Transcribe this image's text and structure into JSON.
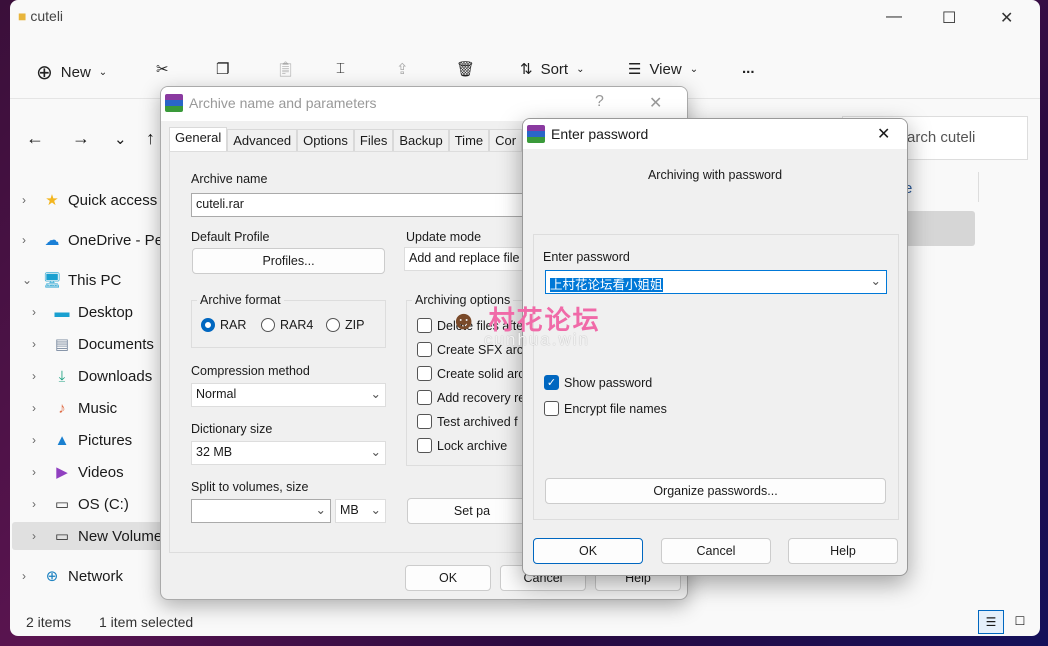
{
  "explorer": {
    "title": "cuteli",
    "toolbar": {
      "new": "New",
      "sort": "Sort",
      "view": "View",
      "more": "..."
    },
    "search_placeholder": "Search cuteli",
    "search_visible": "arch cuteli",
    "col_fragment": "e",
    "sidebar": [
      {
        "label": "Quick access",
        "icon": "star-icon",
        "expanded": false
      },
      {
        "label": "OneDrive - Per",
        "icon": "cloud-icon"
      },
      {
        "label": "This PC",
        "icon": "computer-icon",
        "expanded": true
      },
      {
        "label": "Desktop",
        "icon": "desktop-icon"
      },
      {
        "label": "Documents",
        "icon": "documents-icon"
      },
      {
        "label": "Downloads",
        "icon": "download-icon"
      },
      {
        "label": "Music",
        "icon": "music-icon"
      },
      {
        "label": "Pictures",
        "icon": "pictures-icon"
      },
      {
        "label": "Videos",
        "icon": "videos-icon"
      },
      {
        "label": "OS (C:)",
        "icon": "drive-icon"
      },
      {
        "label": "New Volume",
        "icon": "drive-icon",
        "selected": true
      },
      {
        "label": "Network",
        "icon": "network-icon"
      }
    ],
    "status": {
      "items": "2 items",
      "selected": "1 item selected"
    }
  },
  "archive": {
    "title": "Archive name and parameters",
    "help": "?",
    "tabs": [
      "General",
      "Advanced",
      "Options",
      "Files",
      "Backup",
      "Time",
      "Cor"
    ],
    "archive_name_label": "Archive name",
    "archive_name": "cuteli.rar",
    "default_profile": "Default Profile",
    "profiles": "Profiles...",
    "update_mode_label": "Update mode",
    "update_mode": "Add and replace file",
    "format_label": "Archive format",
    "formats": [
      "RAR",
      "RAR4",
      "ZIP"
    ],
    "format_selected": "RAR",
    "compression_label": "Compression method",
    "compression": "Normal",
    "dict_label": "Dictionary size",
    "dict": "32 MB",
    "split_label": "Split to volumes, size",
    "split_value": "",
    "split_unit": "MB",
    "options_label": "Archiving options",
    "options": [
      "Delete files afte",
      "Create SFX arc",
      "Create solid arc",
      "Add recovery re",
      "Test archived f",
      "Lock archive"
    ],
    "set_password": "Set pa",
    "ok": "OK",
    "cancel": "Cancel",
    "help_btn": "Help"
  },
  "password": {
    "title": "Enter password",
    "subtitle": "Archiving with password",
    "enter_label": "Enter password",
    "value": "上村花论坛看小姐姐",
    "show_password": "Show password",
    "show_checked": true,
    "encrypt_names": "Encrypt file names",
    "encrypt_checked": false,
    "organize": "Organize passwords...",
    "ok": "OK",
    "cancel": "Cancel",
    "help": "Help"
  },
  "watermark": {
    "text": "村花论坛",
    "url": "cunhua.win"
  },
  "colors": {
    "accent": "#0067c0",
    "selection": "#0078d7",
    "watermark": "#f06aa8"
  }
}
